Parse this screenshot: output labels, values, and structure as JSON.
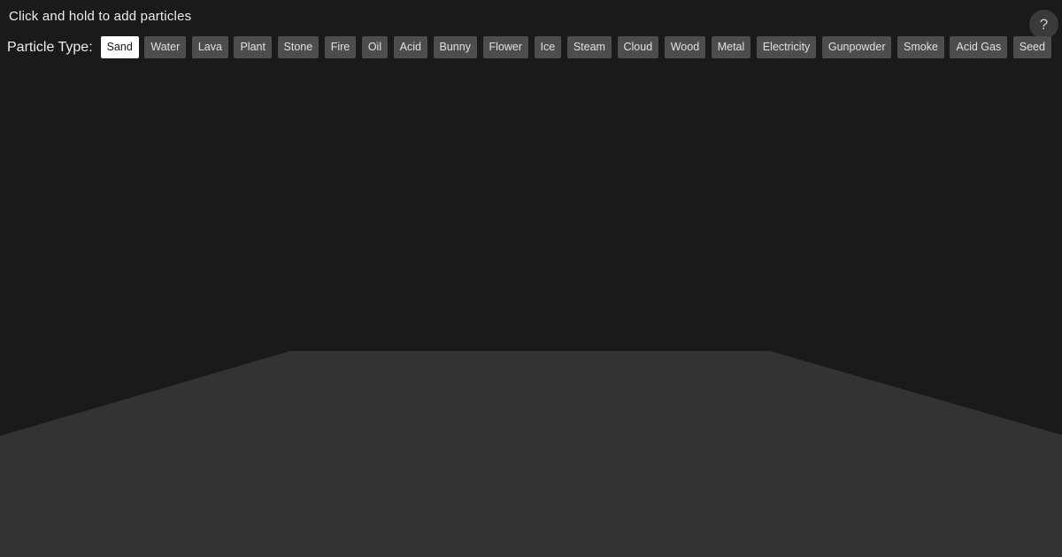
{
  "header": {
    "instructions": "Click and hold to add particles",
    "help_label": "?"
  },
  "toolbar": {
    "label": "Particle Type:",
    "selected_type": "Sand",
    "types": [
      {
        "label": "Sand",
        "selected": true
      },
      {
        "label": "Water",
        "selected": false
      },
      {
        "label": "Lava",
        "selected": false
      },
      {
        "label": "Plant",
        "selected": false
      },
      {
        "label": "Stone",
        "selected": false
      },
      {
        "label": "Fire",
        "selected": false
      },
      {
        "label": "Oil",
        "selected": false
      },
      {
        "label": "Acid",
        "selected": false
      },
      {
        "label": "Bunny",
        "selected": false
      },
      {
        "label": "Flower",
        "selected": false
      },
      {
        "label": "Ice",
        "selected": false
      },
      {
        "label": "Steam",
        "selected": false
      },
      {
        "label": "Cloud",
        "selected": false
      },
      {
        "label": "Wood",
        "selected": false
      },
      {
        "label": "Metal",
        "selected": false
      },
      {
        "label": "Electricity",
        "selected": false
      },
      {
        "label": "Gunpowder",
        "selected": false
      },
      {
        "label": "Smoke",
        "selected": false
      },
      {
        "label": "Acid Gas",
        "selected": false
      },
      {
        "label": "Seed",
        "selected": false
      }
    ]
  },
  "colors": {
    "background": "#1a1a1a",
    "floor": "#333333",
    "text": "#eeeeee",
    "button_background": "#4d4d4d",
    "button_text": "#e0e0e0",
    "selected_button_background": "#ffffff",
    "selected_button_text": "#141414",
    "help_button_background": "#3a3a3a",
    "help_button_text": "#cccccc"
  }
}
